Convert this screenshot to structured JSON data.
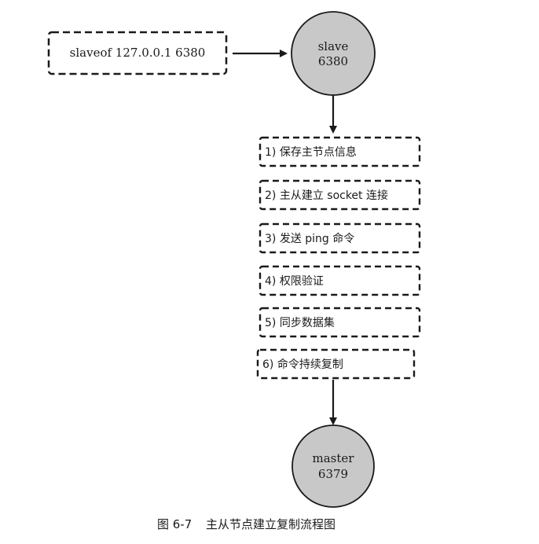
{
  "command": {
    "text": "slaveof 127.0.0.1 6380"
  },
  "slave_node": {
    "name": "slave",
    "port": "6380"
  },
  "steps": [
    "1) 保存主节点信息",
    "2) 主从建立 socket 连接",
    "3) 发送 ping 命令",
    "4) 权限验证",
    "5) 同步数据集",
    "6) 命令持续复制"
  ],
  "master_node": {
    "name": "master",
    "port": "6379"
  },
  "caption": {
    "label": "图 6-7",
    "title": "主从节点建立复制流程图"
  },
  "colors": {
    "node_fill": "#c8c8c8",
    "stroke": "#1a1a1a"
  }
}
